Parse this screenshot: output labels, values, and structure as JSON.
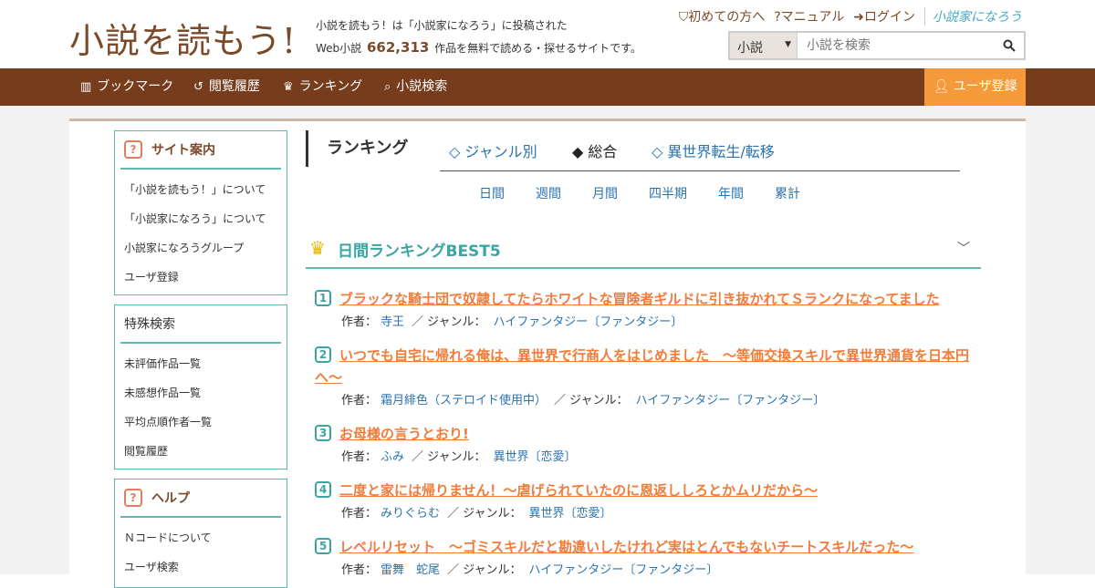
{
  "header": {
    "logo": "小説を読もう!",
    "desc_line1": "小説を読もう！は「小説家になろう」に投稿された",
    "desc_line2_prefix": "Web小説",
    "desc_count": "662,313",
    "desc_line2_suffix": "作品を無料で読める・探せるサイトです。",
    "top_links": [
      "初めての方へ",
      "マニュアル",
      "ログイン"
    ],
    "partner_logo": "小説家になろう",
    "search": {
      "select_value": "小説",
      "placeholder": "小説を検索"
    }
  },
  "nav": {
    "items": [
      "ブックマーク",
      "閲覧履歴",
      "ランキング",
      "小説検索"
    ],
    "register": "ユーザ登録"
  },
  "sidebar": {
    "site_guide": {
      "title": "サイト案内",
      "items": [
        "「小説を読もう！」について",
        "「小説家になろう」について",
        "小説家になろうグループ",
        "ユーザ登録"
      ]
    },
    "special_search": {
      "title": "特殊検索",
      "items": [
        "未評価作品一覧",
        "未感想作品一覧",
        "平均点順作者一覧",
        "閲覧履歴"
      ]
    },
    "help": {
      "title": "ヘルプ",
      "items": [
        "Ｎコードについて",
        "ユーザ検索"
      ]
    }
  },
  "ranking": {
    "title": "ランキング",
    "tabs": [
      "◇ ジャンル別",
      "◆ 総合",
      "◇ 異世界転生/転移"
    ],
    "periods": [
      "日間",
      "週間",
      "月間",
      "四半期",
      "年間",
      "累計"
    ],
    "best_title": "日間ランキングBEST5",
    "author_label": "作者：",
    "genre_label": "／ ジャンル：",
    "entries": [
      {
        "rank": "1",
        "title": "ブラックな騎士団で奴隷してたらホワイトな冒険者ギルドに引き抜かれてＳランクになってました",
        "author": "寺王",
        "genre": "ハイファンタジー〔ファンタジー〕"
      },
      {
        "rank": "2",
        "title": "いつでも自宅に帰れる俺は、異世界で行商人をはじめました　～等価交換スキルで異世界通貨を日本円へ～",
        "author": "霜月緋色（ステロイド使用中）",
        "genre": "ハイファンタジー〔ファンタジー〕"
      },
      {
        "rank": "3",
        "title": "お母様の言うとおり!",
        "author": "ふみ",
        "genre": "異世界〔恋愛〕"
      },
      {
        "rank": "4",
        "title": "二度と家には帰りません！～虐げられていたのに恩返ししろとかムリだから～",
        "author": "みりぐらむ",
        "genre": "異世界〔恋愛〕"
      },
      {
        "rank": "5",
        "title": "レベルリセット　～ゴミスキルだと勘違いしたけれど実はとんでもないチートスキルだった～",
        "author": "雷舞　蛇尾",
        "genre": "ハイファンタジー〔ファンタジー〕"
      }
    ]
  }
}
